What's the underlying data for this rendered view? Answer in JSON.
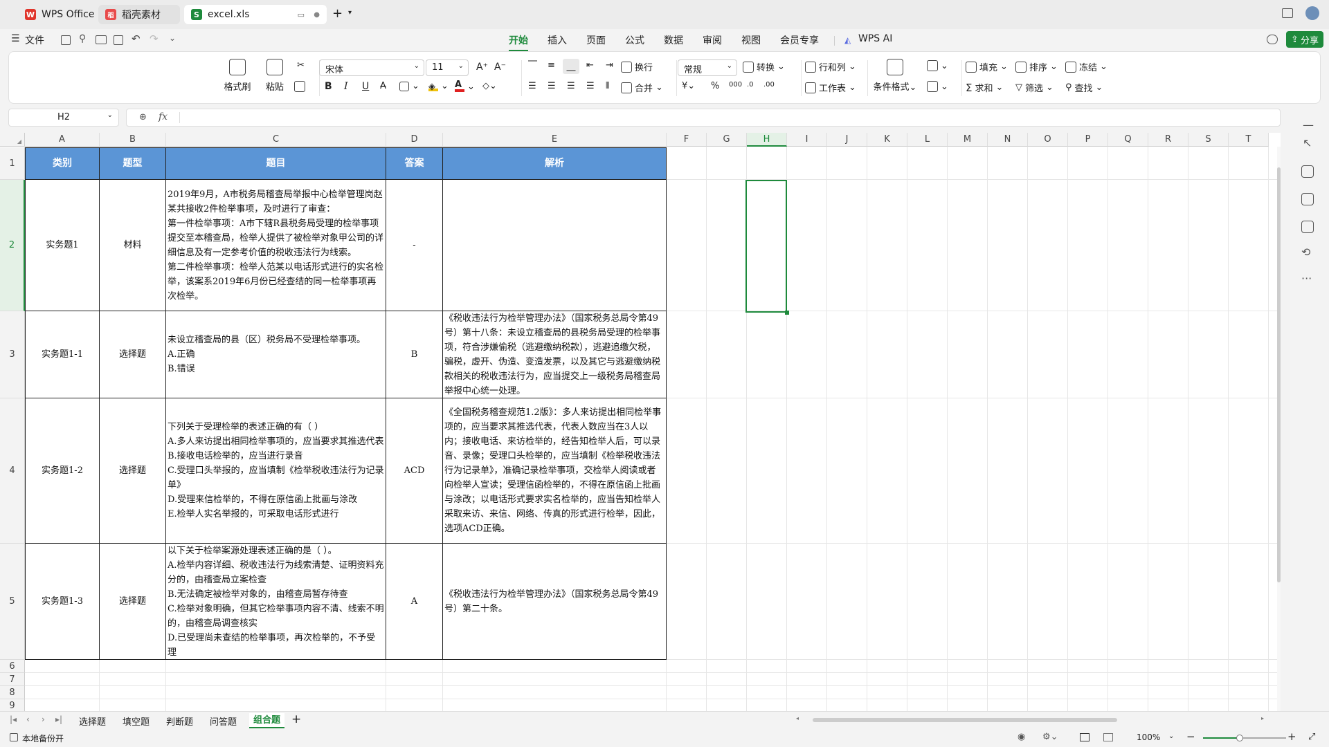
{
  "tabs": [
    {
      "label": "WPS Office",
      "icon": "W"
    },
    {
      "label": "稻壳素材",
      "icon": "稻"
    },
    {
      "label": "excel.xls",
      "icon": "S"
    }
  ],
  "menu": {
    "file": "文件",
    "items": [
      "开始",
      "插入",
      "页面",
      "公式",
      "数据",
      "审阅",
      "视图",
      "会员专享"
    ],
    "wps_ai": "WPS AI",
    "share": "分享"
  },
  "ribbon": {
    "format_painter": "格式刷",
    "paste": "粘贴",
    "font_name": "宋体",
    "font_size": "11",
    "wrap": "换行",
    "merge": "合并",
    "number_format": "常规",
    "convert": "转换",
    "row_col": "行和列",
    "worksheet": "工作表",
    "cond_format": "条件格式",
    "fill": "填充",
    "sort": "排序",
    "freeze": "冻结",
    "sum": "求和",
    "filter": "筛选",
    "find": "查找"
  },
  "formula_bar": {
    "cell_ref": "H2",
    "fx": "fx",
    "value": ""
  },
  "columns": [
    "A",
    "B",
    "C",
    "D",
    "E",
    "F",
    "G",
    "H",
    "I",
    "J",
    "K",
    "L",
    "M",
    "N",
    "O",
    "P",
    "Q",
    "R",
    "S",
    "T"
  ],
  "rows": [
    "1",
    "2",
    "3",
    "4",
    "5",
    "6",
    "7",
    "8",
    "9"
  ],
  "table": {
    "headers": [
      "类别",
      "题型",
      "题目",
      "答案",
      "解析"
    ],
    "rows": [
      {
        "category": "实务题1",
        "type": "材料",
        "question": "2019年9月，A市税务局稽查局举报中心检举管理岗赵某共接收2件检举事项，及时进行了审查：\n第一件检举事项：A市下辖R县税务局受理的检举事项提交至本稽查局，检举人提供了被检举对象甲公司的详细信息及有一定参考价值的税收违法行为线索。\n第二件检举事项：检举人范某以电话形式进行的实名检举，该案系2019年6月份已经查结的同一检举事项再次检举。",
        "answer": "-",
        "analysis": ""
      },
      {
        "category": "实务题1-1",
        "type": "选择题",
        "question": "未设立稽查局的县（区）税务局不受理检举事项。\nA.正确\nB.错误",
        "answer": "B",
        "analysis": "《税收违法行为检举管理办法》（国家税务总局令第49号）第十八条：未设立稽查局的县税务局受理的检举事项，符合涉嫌偷税（逃避缴纳税款），逃避追缴欠税，骗税，虚开、伪造、变造发票，以及其它与逃避缴纳税款相关的税收违法行为，应当提交上一级税务局稽查局举报中心统一处理。"
      },
      {
        "category": "实务题1-2",
        "type": "选择题",
        "question": "下列关于受理检举的表述正确的有（ ）\nA.多人来访提出相同检举事项的，应当要求其推选代表\nB.接收电话检举的，应当进行录音\nC.受理口头举报的，应当填制《检举税收违法行为记录单》\nD.受理来信检举的，不得在原信函上批画与涂改\nE.检举人实名举报的，可采取电话形式进行",
        "answer": "ACD",
        "analysis": "《全国税务稽查规范1.2版》：多人来访提出相同检举事项的，应当要求其推选代表，代表人数应当在3人以内；接收电话、来访检举的，经告知检举人后，可以录音、录像；受理口头检举的，应当填制《检举税收违法行为记录单》，准确记录检举事项，交检举人阅读或者向检举人宣读；受理信函检举的，不得在原信函上批画与涂改；以电话形式要求实名检举的，应当告知检举人采取来访、来信、网络、传真的形式进行检举，因此，选项ACD正确。"
      },
      {
        "category": "实务题1-3",
        "type": "选择题",
        "question": "以下关于检举案源处理表述正确的是（ ）。\nA.检举内容详细、税收违法行为线索清楚、证明资料充分的，由稽查局立案检查\nB.无法确定被检举对象的，由稽查局暂存待查\nC.检举对象明确，但其它检举事项内容不清、线索不明的，由稽查局调查核实\nD.已受理尚未查结的检举事项，再次检举的，不予受理",
        "answer": "A",
        "analysis": "《税收违法行为检举管理办法》（国家税务总局令第49号）第二十条。"
      }
    ]
  },
  "sheets": [
    "选择题",
    "填空题",
    "判断题",
    "问答题",
    "组合题"
  ],
  "active_sheet": "组合题",
  "status": {
    "backup": "本地备份开",
    "zoom": "100%"
  },
  "colors": {
    "accent": "#1e8a3c",
    "header_fill": "#5b95d6"
  }
}
